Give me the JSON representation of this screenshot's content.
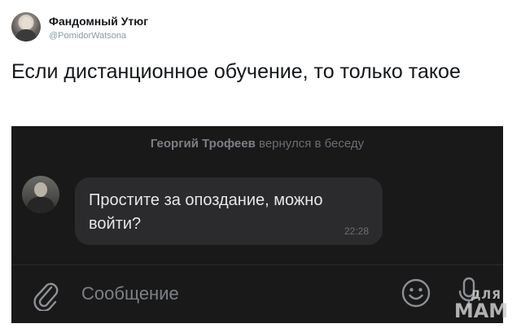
{
  "tweet": {
    "author_name": "Фандомный Утюг",
    "author_handle": "@PomidorWatsona",
    "text": "Если дистанционное обучение, то только такое"
  },
  "chat": {
    "system_message": {
      "user": "Георгий Трофеев",
      "action": "вернулся в беседу"
    },
    "message": {
      "text": "Простите за опоздание, можно войти?",
      "time": "22:28"
    },
    "input": {
      "placeholder": "Сообщение"
    },
    "icons": {
      "attach": "paperclip-icon",
      "emoji": "smiley-icon",
      "voice": "microphone-icon"
    },
    "colors": {
      "background": "#19191a",
      "bubble": "#2b2b2d",
      "text": "#e6e6e6",
      "muted": "#6a6d72"
    }
  },
  "watermark": {
    "top": "ДЛЯ",
    "bottom": "МАМ"
  }
}
